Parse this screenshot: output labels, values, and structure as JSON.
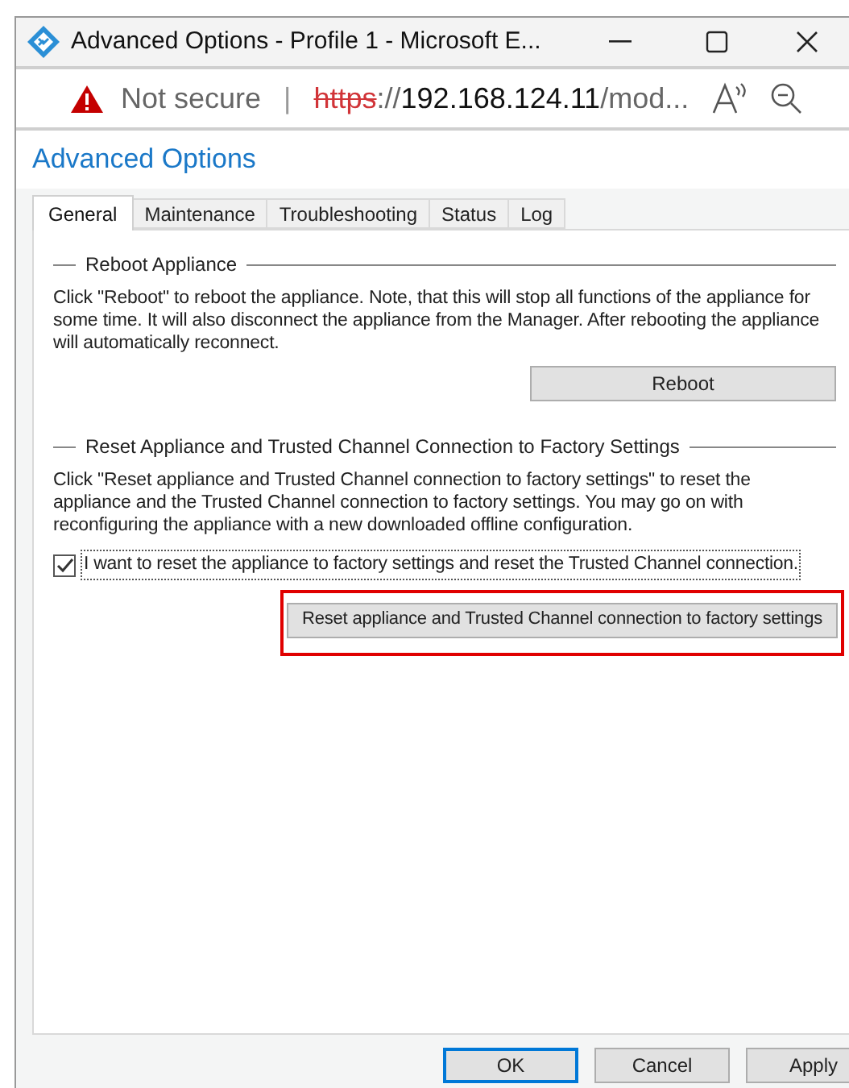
{
  "window": {
    "title": "Advanced Options - Profile 1 - Microsoft E..."
  },
  "address_bar": {
    "security": "Not secure",
    "separator": "|",
    "scheme": "https",
    "scheme_separator": "://",
    "host": "192.168.124.11",
    "path": "/mod..."
  },
  "page_title": "Advanced Options",
  "tabs": [
    {
      "label": "General",
      "selected": true
    },
    {
      "label": "Maintenance",
      "selected": false
    },
    {
      "label": "Troubleshooting",
      "selected": false
    },
    {
      "label": "Status",
      "selected": false
    },
    {
      "label": "Log",
      "selected": false
    }
  ],
  "sections": [
    {
      "title": "Reboot Appliance",
      "description": "Click \"Reboot\" to reboot the appliance. Note, that this will stop all functions of the appliance for some time. It will also disconnect the appliance from the Manager. After rebooting the appliance will automatically reconnect.",
      "button": {
        "label": "Reboot",
        "highlighted": false
      }
    },
    {
      "title": "Reset Appliance and Trusted Channel Connection to Factory Settings",
      "description": "Click \"Reset appliance and Trusted Channel connection to factory settings\" to reset the appliance and the Trusted Channel connection to factory settings. You may go on with reconfiguring the appliance with a new downloaded offline configuration.",
      "checkbox": {
        "label": "I want to reset the appliance to factory settings and reset the Trusted Channel connection.",
        "checked": true
      },
      "button": {
        "label": "Reset appliance and Trusted Channel connection to factory settings",
        "highlighted": true
      }
    }
  ],
  "footer_buttons": [
    {
      "label": "OK",
      "selected": true
    },
    {
      "label": "Cancel",
      "selected": false
    },
    {
      "label": "Apply",
      "selected": false
    }
  ]
}
